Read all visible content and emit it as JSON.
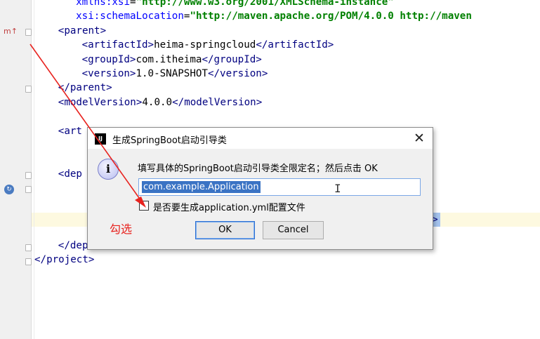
{
  "editor": {
    "lines": [
      {
        "indent": 7,
        "parts": [
          [
            "attr",
            "xmlns:xsi"
          ],
          [
            "plain",
            "="
          ],
          [
            "str",
            "\"http://www.w3.org/2001/XMLSchema-instance\""
          ]
        ]
      },
      {
        "indent": 7,
        "parts": [
          [
            "attr",
            "xsi:schemaLocation"
          ],
          [
            "plain",
            "="
          ],
          [
            "str",
            "\"http://maven.apache.org/POM/4.0.0 http://maven"
          ]
        ]
      },
      {
        "indent": 4,
        "parts": [
          [
            "tag",
            "<parent>"
          ]
        ]
      },
      {
        "indent": 8,
        "parts": [
          [
            "tag",
            "<artifactId>"
          ],
          [
            "plain",
            "heima-springcloud"
          ],
          [
            "tag",
            "</artifactId>"
          ]
        ]
      },
      {
        "indent": 8,
        "parts": [
          [
            "tag",
            "<groupId>"
          ],
          [
            "plain",
            "com.itheima"
          ],
          [
            "tag",
            "</groupId>"
          ]
        ]
      },
      {
        "indent": 8,
        "parts": [
          [
            "tag",
            "<version>"
          ],
          [
            "plain",
            "1.0-SNAPSHOT"
          ],
          [
            "tag",
            "</version>"
          ]
        ]
      },
      {
        "indent": 4,
        "parts": [
          [
            "tag",
            "</parent>"
          ]
        ]
      },
      {
        "indent": 4,
        "parts": [
          [
            "tag",
            "<modelVersion>"
          ],
          [
            "plain",
            "4.0.0"
          ],
          [
            "tag",
            "</modelVersion>"
          ]
        ]
      },
      {
        "indent": 0,
        "parts": []
      },
      {
        "indent": 4,
        "parts": [
          [
            "tag",
            "<art"
          ]
        ]
      },
      {
        "indent": 0,
        "parts": []
      },
      {
        "indent": 0,
        "parts": []
      },
      {
        "indent": 4,
        "parts": [
          [
            "tag",
            "<dep"
          ]
        ]
      },
      {
        "indent": 0,
        "parts": []
      },
      {
        "indent": 0,
        "parts": []
      },
      {
        "indent": 0,
        "parts": []
      },
      {
        "indent": 0,
        "parts": []
      },
      {
        "indent": 4,
        "parts": [
          [
            "tag",
            "</dependencies>"
          ]
        ]
      },
      {
        "indent": 0,
        "parts": [
          [
            "tag",
            "</project>"
          ]
        ]
      }
    ],
    "selection_fragment": ">",
    "gutter_marker": "m",
    "gutter_marker_arrow": "↑"
  },
  "dialog": {
    "title": "生成SpringBoot启动引导类",
    "app_icon": "IJ",
    "close_label": "✕",
    "prompt": "填写具体的SpringBoot启动引导类全限定名；然后点击 OK",
    "input_value": "com.example.Application",
    "checkbox_label": "是否要生成application.yml配置文件",
    "checkbox_checked": false,
    "ok_label": "OK",
    "cancel_label": "Cancel",
    "info_icon_glyph": "i"
  },
  "annotation": {
    "text": "勾选",
    "color": "#e8231f"
  }
}
